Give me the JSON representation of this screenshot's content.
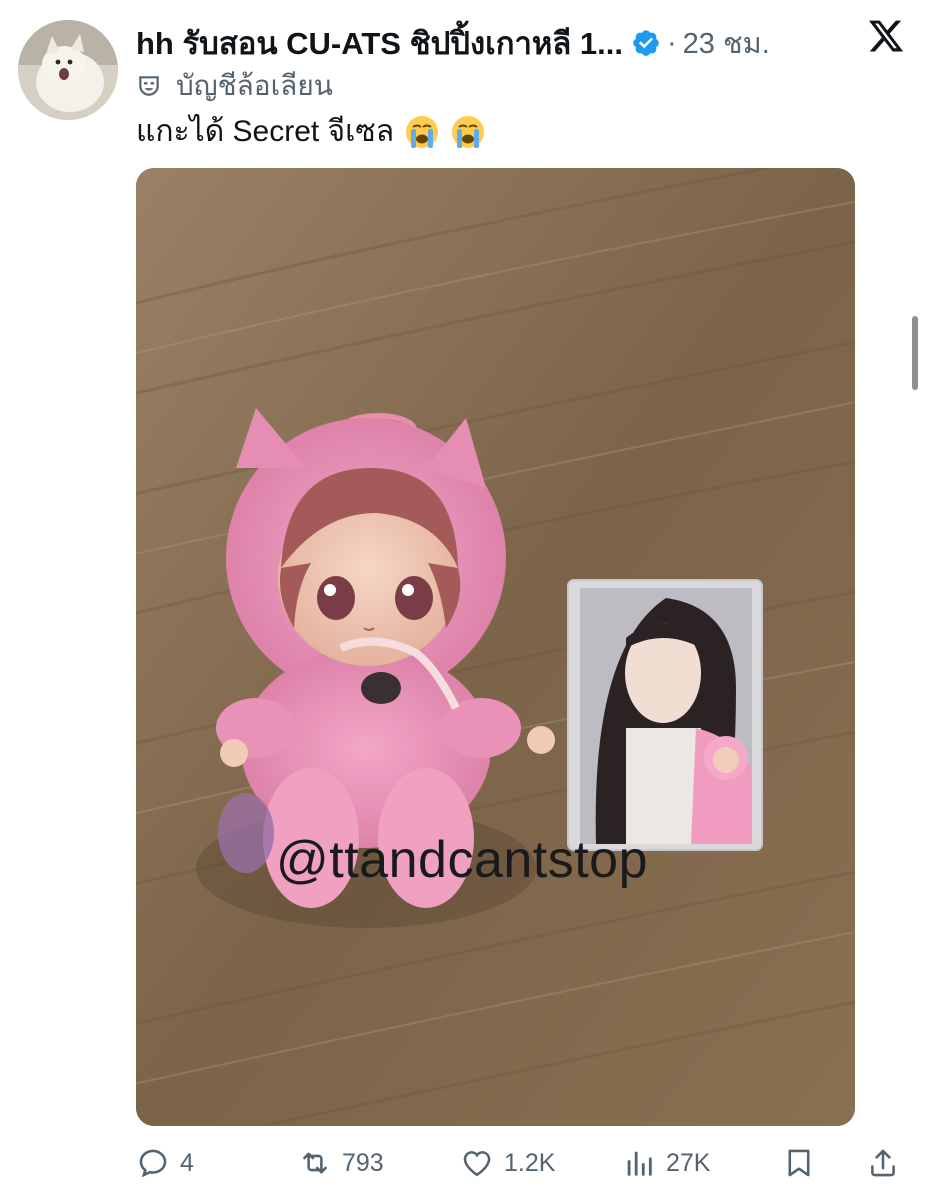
{
  "post": {
    "display_name": "hh รับสอน CU-ATS ชิปปิ้งเกาหลี 1...",
    "dot": "·",
    "time": "23 ชม.",
    "parody_label": "บัญชีล้อเลียน",
    "text": "แกะได้ Secret จีเซล",
    "emojis": [
      "loudly-crying-face",
      "loudly-crying-face"
    ],
    "media_watermark": "@ttandcantstop"
  },
  "icons": {
    "verified": "verified-badge-icon",
    "logo": "x-logo-icon",
    "parody": "theater-mask-icon"
  },
  "actions": {
    "reply_count": "4",
    "repost_count": "793",
    "like_count": "1.2K",
    "views_count": "27K"
  },
  "colors": {
    "text_primary": "#0f1419",
    "text_secondary": "#536471",
    "verified_blue": "#1d9bf0"
  }
}
